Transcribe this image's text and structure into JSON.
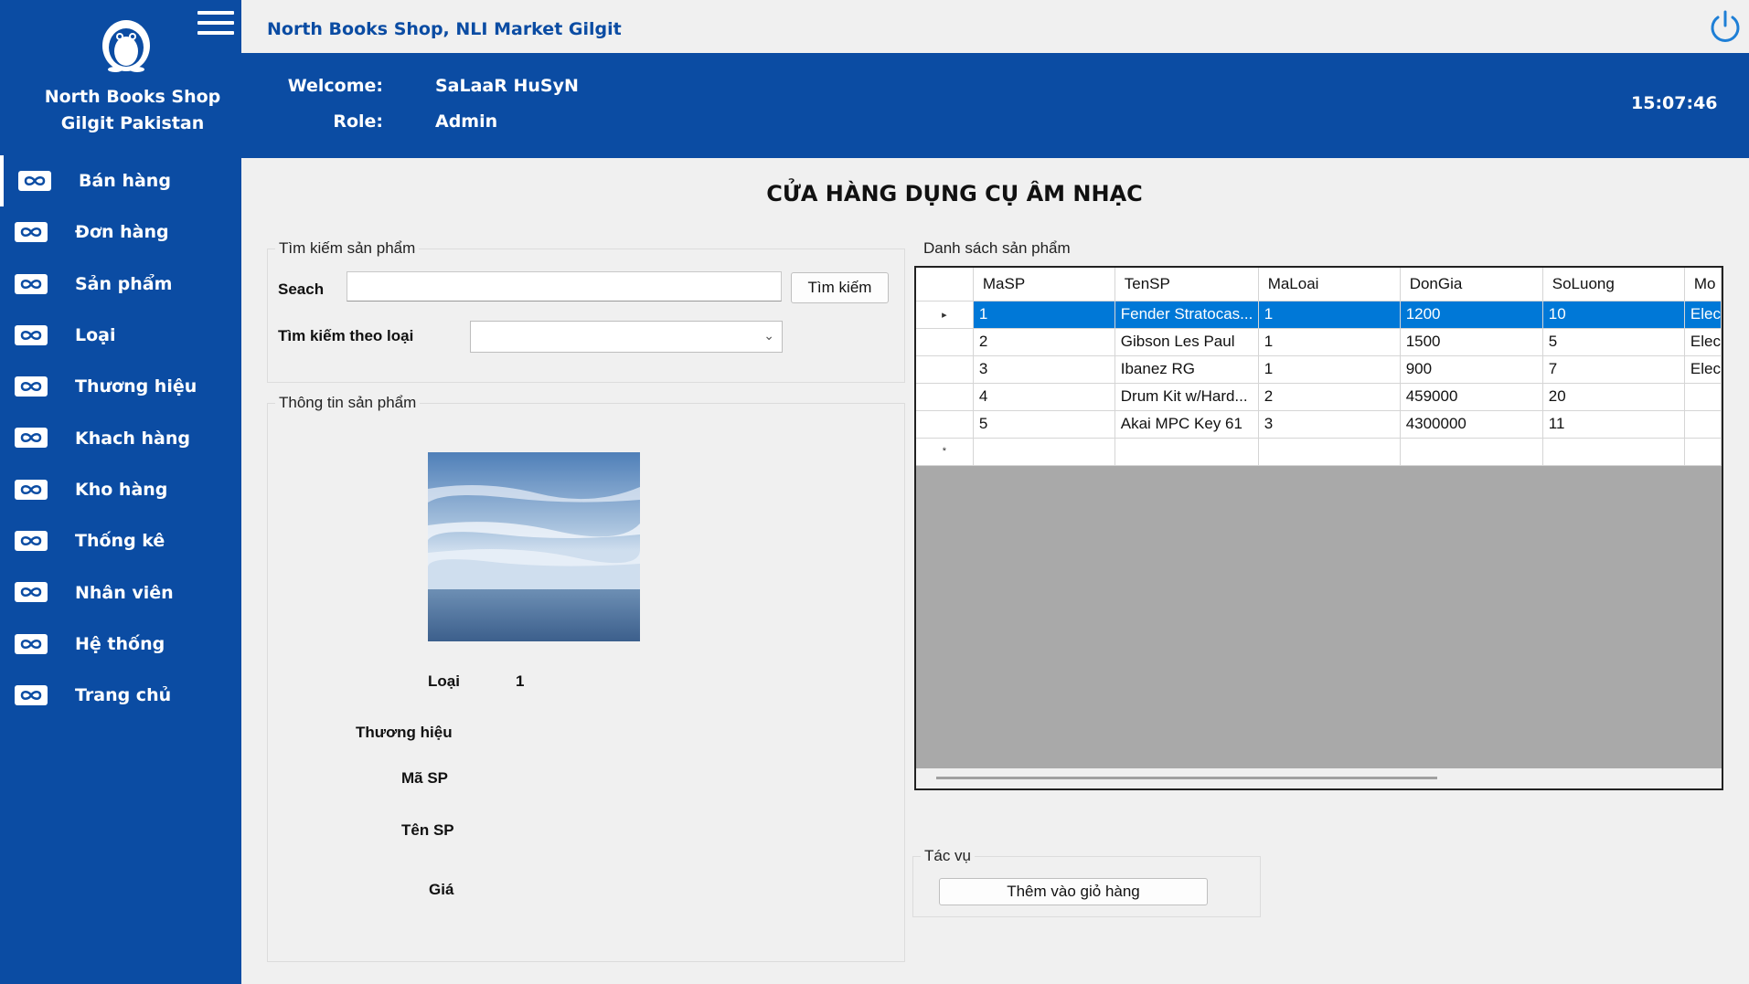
{
  "sidebar": {
    "shop_name_line1": "North Books Shop",
    "shop_name_line2": "Gilgit Pakistan",
    "items": [
      {
        "label": "Bán hàng"
      },
      {
        "label": "Đơn hàng"
      },
      {
        "label": "Sản phẩm"
      },
      {
        "label": "Loại"
      },
      {
        "label": "Thương hiệu"
      },
      {
        "label": "Khach hàng"
      },
      {
        "label": "Kho hàng"
      },
      {
        "label": "Thống kê"
      },
      {
        "label": "Nhân viên"
      },
      {
        "label": "Hệ thống"
      },
      {
        "label": "Trang chủ"
      }
    ]
  },
  "topbar": {
    "title": "North Books Shop, NLI Market Gilgit"
  },
  "header": {
    "welcome_label": "Welcome:",
    "welcome_value": "SaLaaR HuSyN",
    "role_label": "Role:",
    "role_value": "Admin",
    "clock": "15:07:46"
  },
  "main": {
    "title": "CỬA HÀNG DỤNG CỤ ÂM NHẠC",
    "search_group": {
      "caption": "Tìm kiếm sản phẩm",
      "search_label": "Seach",
      "search_value": "",
      "search_button": "Tìm kiếm",
      "category_label": "Tìm kiếm theo loại",
      "category_value": ""
    },
    "info_group": {
      "caption": "Thông tin sản phẩm",
      "loai_label": "Loại",
      "loai_value": "1",
      "thuonghieu_label": "Thương hiệu",
      "masp_label": "Mã SP",
      "tensp_label": "Tên SP",
      "gia_label": "Giá"
    },
    "list_group": {
      "caption": "Danh sách sản phẩm",
      "columns": [
        "MaSP",
        "TenSP",
        "MaLoai",
        "DonGia",
        "SoLuong",
        "Mo"
      ],
      "rows": [
        [
          "1",
          "Fender Stratocas...",
          "1",
          "1200",
          "10",
          "Elec"
        ],
        [
          "2",
          "Gibson Les Paul",
          "1",
          "1500",
          "5",
          "Elec"
        ],
        [
          "3",
          "Ibanez RG",
          "1",
          "900",
          "7",
          "Elec"
        ],
        [
          "4",
          "Drum Kit w/Hard...",
          "2",
          "459000",
          "20",
          ""
        ],
        [
          "5",
          "Akai MPC Key 61",
          "3",
          "4300000",
          "11",
          ""
        ]
      ],
      "selected_row_marker": "▸",
      "new_row_marker": "*"
    },
    "actions_group": {
      "caption": "Tác vụ",
      "add_to_cart": "Thêm vào giỏ hàng"
    }
  },
  "colors": {
    "brand": "#0b4ca3",
    "selection": "#0078d7"
  }
}
